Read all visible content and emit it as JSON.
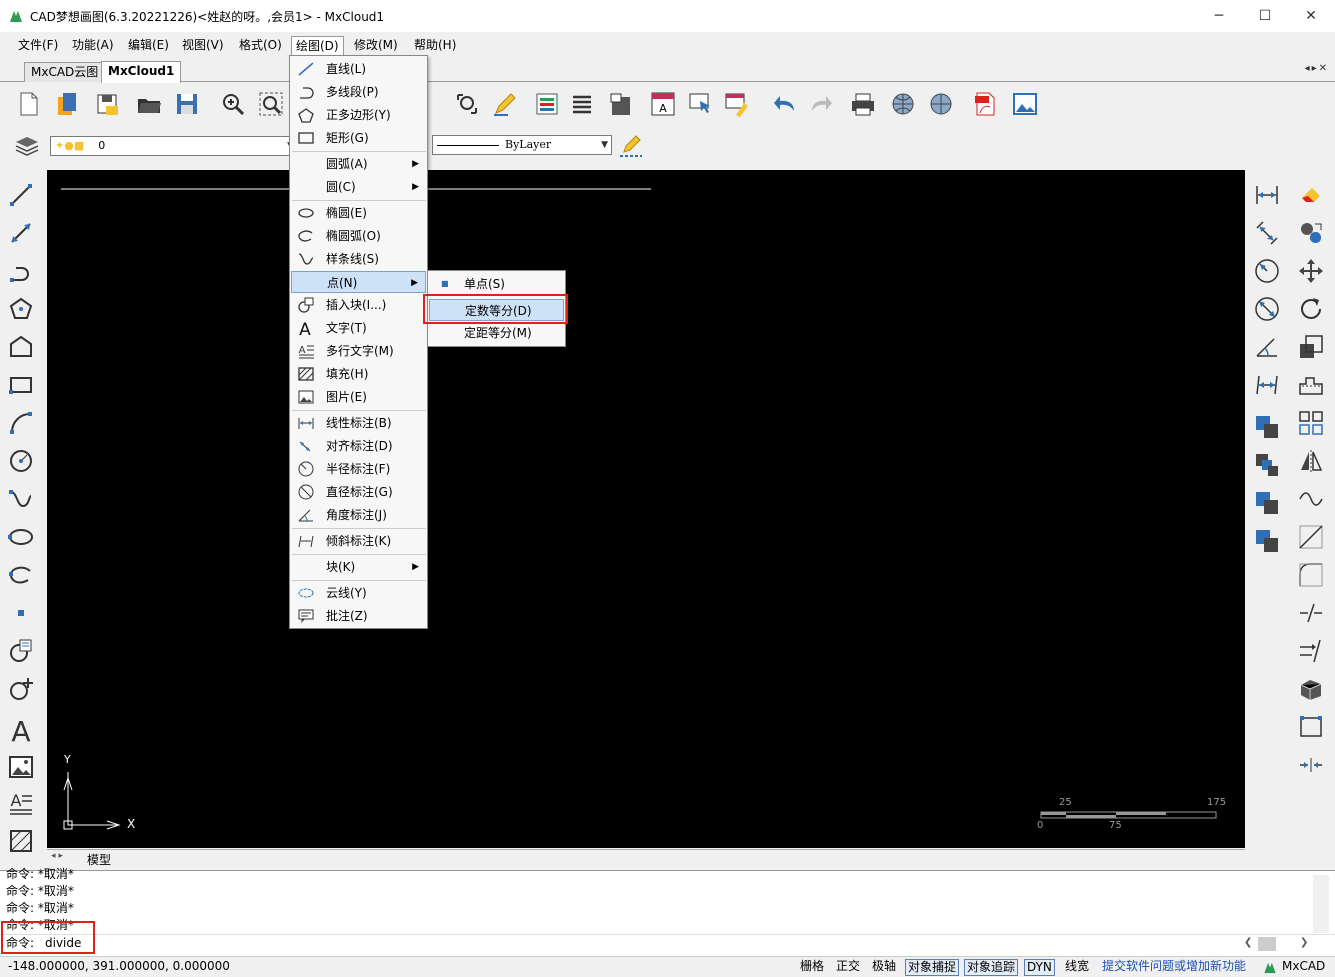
{
  "window": {
    "title": "CAD梦想画图(6.3.20221226)<姓赵的呀。,会员1> - MxCloud1",
    "minimize": "─",
    "maximize": "☐",
    "close": "✕"
  },
  "menubar": {
    "items": [
      "文件(F)",
      "功能(A)",
      "编辑(E)",
      "视图(V)",
      "格式(O)",
      "绘图(D)",
      "修改(M)",
      "帮助(H)"
    ],
    "active_index": 5
  },
  "tabs": {
    "items": [
      "MxCAD云图",
      "MxCloud1"
    ],
    "active_index": 1,
    "nav": "◂▸✕"
  },
  "propbar": {
    "layer_value": "0",
    "linetype_value": "ByLayer"
  },
  "draw_menu": {
    "items": [
      {
        "label": "直线(L)",
        "icon": "line-icon"
      },
      {
        "label": "多线段(P)",
        "icon": "polyline-icon"
      },
      {
        "label": "正多边形(Y)",
        "icon": "polygon-icon"
      },
      {
        "label": "矩形(G)",
        "icon": "rectangle-icon"
      },
      {
        "label": "圆弧(A)",
        "icon": "",
        "submenu": true
      },
      {
        "label": "圆(C)",
        "icon": "",
        "submenu": true
      },
      {
        "label": "椭圆(E)",
        "icon": "ellipse-icon"
      },
      {
        "label": "椭圆弧(O)",
        "icon": "ellipse-arc-icon"
      },
      {
        "label": "样条线(S)",
        "icon": "spline-icon"
      },
      {
        "label": "点(N)",
        "icon": "",
        "submenu": true,
        "highlighted": true
      },
      {
        "label": "插入块(I...)",
        "icon": "insert-block-icon"
      },
      {
        "label": "文字(T)",
        "icon": "text-icon"
      },
      {
        "label": "多行文字(M)",
        "icon": "mtext-icon"
      },
      {
        "label": "填充(H)",
        "icon": "hatch-icon"
      },
      {
        "label": "图片(E)",
        "icon": "image-icon"
      },
      {
        "label": "线性标注(B)",
        "icon": "linear-dim-icon"
      },
      {
        "label": "对齐标注(D)",
        "icon": "aligned-dim-icon"
      },
      {
        "label": "半径标注(F)",
        "icon": "radius-dim-icon"
      },
      {
        "label": "直径标注(G)",
        "icon": "diameter-dim-icon"
      },
      {
        "label": "角度标注(J)",
        "icon": "angle-dim-icon"
      },
      {
        "label": "倾斜标注(K)",
        "icon": "oblique-dim-icon"
      },
      {
        "label": "块(K)",
        "icon": "",
        "submenu": true
      },
      {
        "label": "云线(Y)",
        "icon": "revcloud-icon"
      },
      {
        "label": "批注(Z)",
        "icon": "comment-icon"
      }
    ]
  },
  "point_submenu": {
    "items": [
      {
        "label": "单点(S)"
      },
      {
        "label": "定数等分(D)",
        "highlighted": true
      },
      {
        "label": "定距等分(M)"
      }
    ]
  },
  "canvas": {
    "ucs_y": "Y",
    "ucs_x": "X",
    "scale_top": [
      "25",
      "175"
    ],
    "scale_bottom": [
      "0",
      "75"
    ]
  },
  "model_tab": "模型",
  "command": {
    "history": [
      "命令:  *取消*",
      "命令:  *取消*",
      "命令:  *取消*",
      "命令:  *取消*"
    ],
    "prompt": "命令:",
    "input": "divide"
  },
  "status": {
    "coords": "-148.000000,  391.000000,  0.000000",
    "toggles": [
      {
        "label": "栅格",
        "on": false
      },
      {
        "label": "正交",
        "on": false
      },
      {
        "label": "极轴",
        "on": false
      },
      {
        "label": "对象捕捉",
        "on": true
      },
      {
        "label": "对象追踪",
        "on": true
      },
      {
        "label": "DYN",
        "on": true
      },
      {
        "label": "线宽",
        "on": false
      }
    ],
    "feedback_link": "提交软件问题或增加新功能",
    "brand": "MxCAD"
  },
  "colors": {
    "accent_blue": "#2f6fb5",
    "highlight": "#cde2f7",
    "annotation_red": "#e0201a",
    "canvas_bg": "#000000"
  }
}
